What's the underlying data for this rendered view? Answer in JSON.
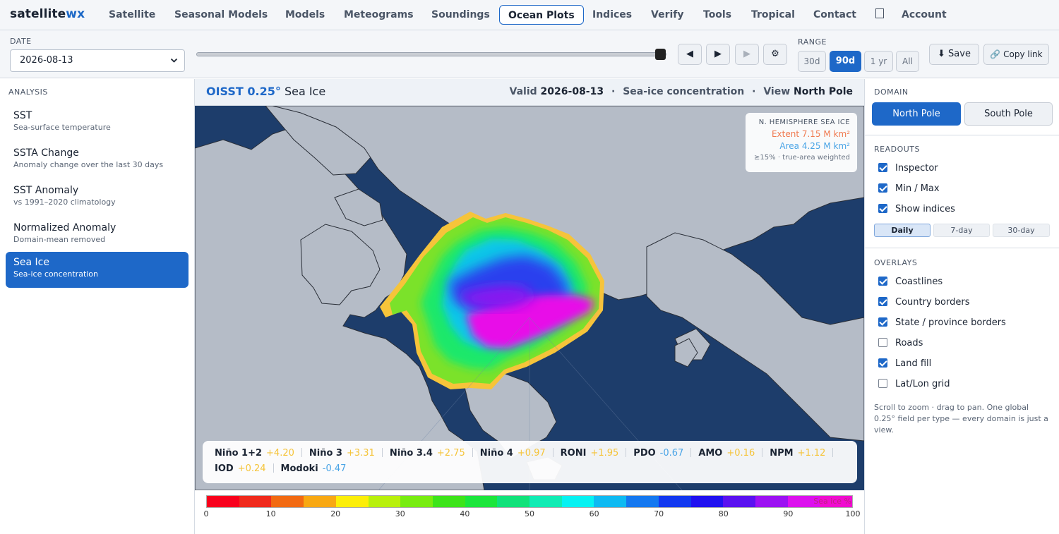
{
  "brand": {
    "name": "satellite",
    "suffix": "wx"
  },
  "nav": {
    "items": [
      "Satellite",
      "Seasonal Models",
      "Models",
      "Meteograms",
      "Soundings",
      "Ocean Plots",
      "Indices",
      "Verify",
      "Tools",
      "Tropical",
      "Contact"
    ],
    "active": "Ocean Plots",
    "icon": "person-icon",
    "account": "Account"
  },
  "controls": {
    "date_label": "DATE",
    "date_value": "2026-08-13",
    "slider_value": 1.0,
    "prev_icon": "◀",
    "play_icon": "▶",
    "next_icon": "▶",
    "settings_icon": "⚙",
    "range_label": "RANGE",
    "ranges": [
      "30d",
      "90d",
      "1 yr",
      "All"
    ],
    "range_active": "90d",
    "save_label": "⬇ Save",
    "copy_label": "🔗 Copy link"
  },
  "sidebar": {
    "heading": "ANALYSIS",
    "items": [
      {
        "title": "SST",
        "subtitle": "Sea-surface temperature"
      },
      {
        "title": "SSTA Change",
        "subtitle": "Anomaly change over the last 30 days"
      },
      {
        "title": "SST Anomaly",
        "subtitle": "vs 1991–2020 climatology"
      },
      {
        "title": "Normalized Anomaly",
        "subtitle": "Domain-mean removed"
      },
      {
        "title": "Sea Ice",
        "subtitle": "Sea-ice concentration"
      }
    ],
    "active": "Sea Ice"
  },
  "map_header": {
    "product": "OISST 0.25°",
    "field": "Sea Ice",
    "valid_label": "Valid",
    "valid_date": "2026-08-13",
    "dot": "·",
    "variable": "Sea-ice concentration",
    "view_label": "View",
    "view": "North Pole"
  },
  "extent_box": {
    "title": "N. HEMISPHERE SEA ICE",
    "extent": "Extent 7.15 M km²",
    "area": "Area 4.25 M km²",
    "note": "≥15% · true-area weighted"
  },
  "indices": [
    [
      {
        "name": "Niño 1+2",
        "value": "+4.20",
        "sign": "pos"
      },
      {
        "name": "Niño 3",
        "value": "+3.31",
        "sign": "pos"
      },
      {
        "name": "Niño 3.4",
        "value": "+2.75",
        "sign": "pos"
      },
      {
        "name": "Niño 4",
        "value": "+0.97",
        "sign": "pos"
      },
      {
        "name": "RONI",
        "value": "+1.95",
        "sign": "pos"
      },
      {
        "name": "PDO",
        "value": "-0.67",
        "sign": "neg"
      },
      {
        "name": "AMO",
        "value": "+0.16",
        "sign": "pos"
      },
      {
        "name": "NPM",
        "value": "+1.12",
        "sign": "pos"
      }
    ],
    [
      {
        "name": "IOD",
        "value": "+0.24",
        "sign": "pos"
      },
      {
        "name": "Modoki",
        "value": "-0.47",
        "sign": "neg"
      }
    ]
  ],
  "colorbar": {
    "unit": "Sea ice %",
    "ticks": [
      "0",
      "10",
      "20",
      "30",
      "40",
      "50",
      "60",
      "70",
      "80",
      "90",
      "100"
    ],
    "colors": [
      "#f8001c",
      "#f02a1c",
      "#f26a12",
      "#f8a812",
      "#fcee08",
      "#b8f00c",
      "#78ec10",
      "#3de41a",
      "#1ce63c",
      "#10e27a",
      "#10ecb4",
      "#06f2f2",
      "#0ebaf2",
      "#1478f0",
      "#1238f0",
      "#2010f0",
      "#5a10f0",
      "#9c10f2",
      "#dc10ee",
      "#f00cd0"
    ]
  },
  "right_panel": {
    "domain_heading": "DOMAIN",
    "domains": [
      "North Pole",
      "South Pole"
    ],
    "domain_active": "North Pole",
    "readouts_heading": "READOUTS",
    "readouts": [
      {
        "label": "Inspector",
        "checked": true
      },
      {
        "label": "Min / Max",
        "checked": true
      },
      {
        "label": "Show indices",
        "checked": true
      }
    ],
    "periods": [
      "Daily",
      "7-day",
      "30-day"
    ],
    "period_active": "Daily",
    "overlays_heading": "OVERLAYS",
    "overlays": [
      {
        "label": "Coastlines",
        "checked": true
      },
      {
        "label": "Country borders",
        "checked": true
      },
      {
        "label": "State / province borders",
        "checked": true
      },
      {
        "label": "Roads",
        "checked": false
      },
      {
        "label": "Land fill",
        "checked": true
      },
      {
        "label": "Lat/Lon grid",
        "checked": false
      }
    ],
    "help": "Scroll to zoom · drag to pan. One global 0.25° field per type — every domain is just a view."
  },
  "colors": {
    "accent": "#1e68c8",
    "ocean": "#1d3d6b",
    "land": "#b5bcc7",
    "positive": "#f5c43a",
    "negative": "#4aa4e6"
  }
}
